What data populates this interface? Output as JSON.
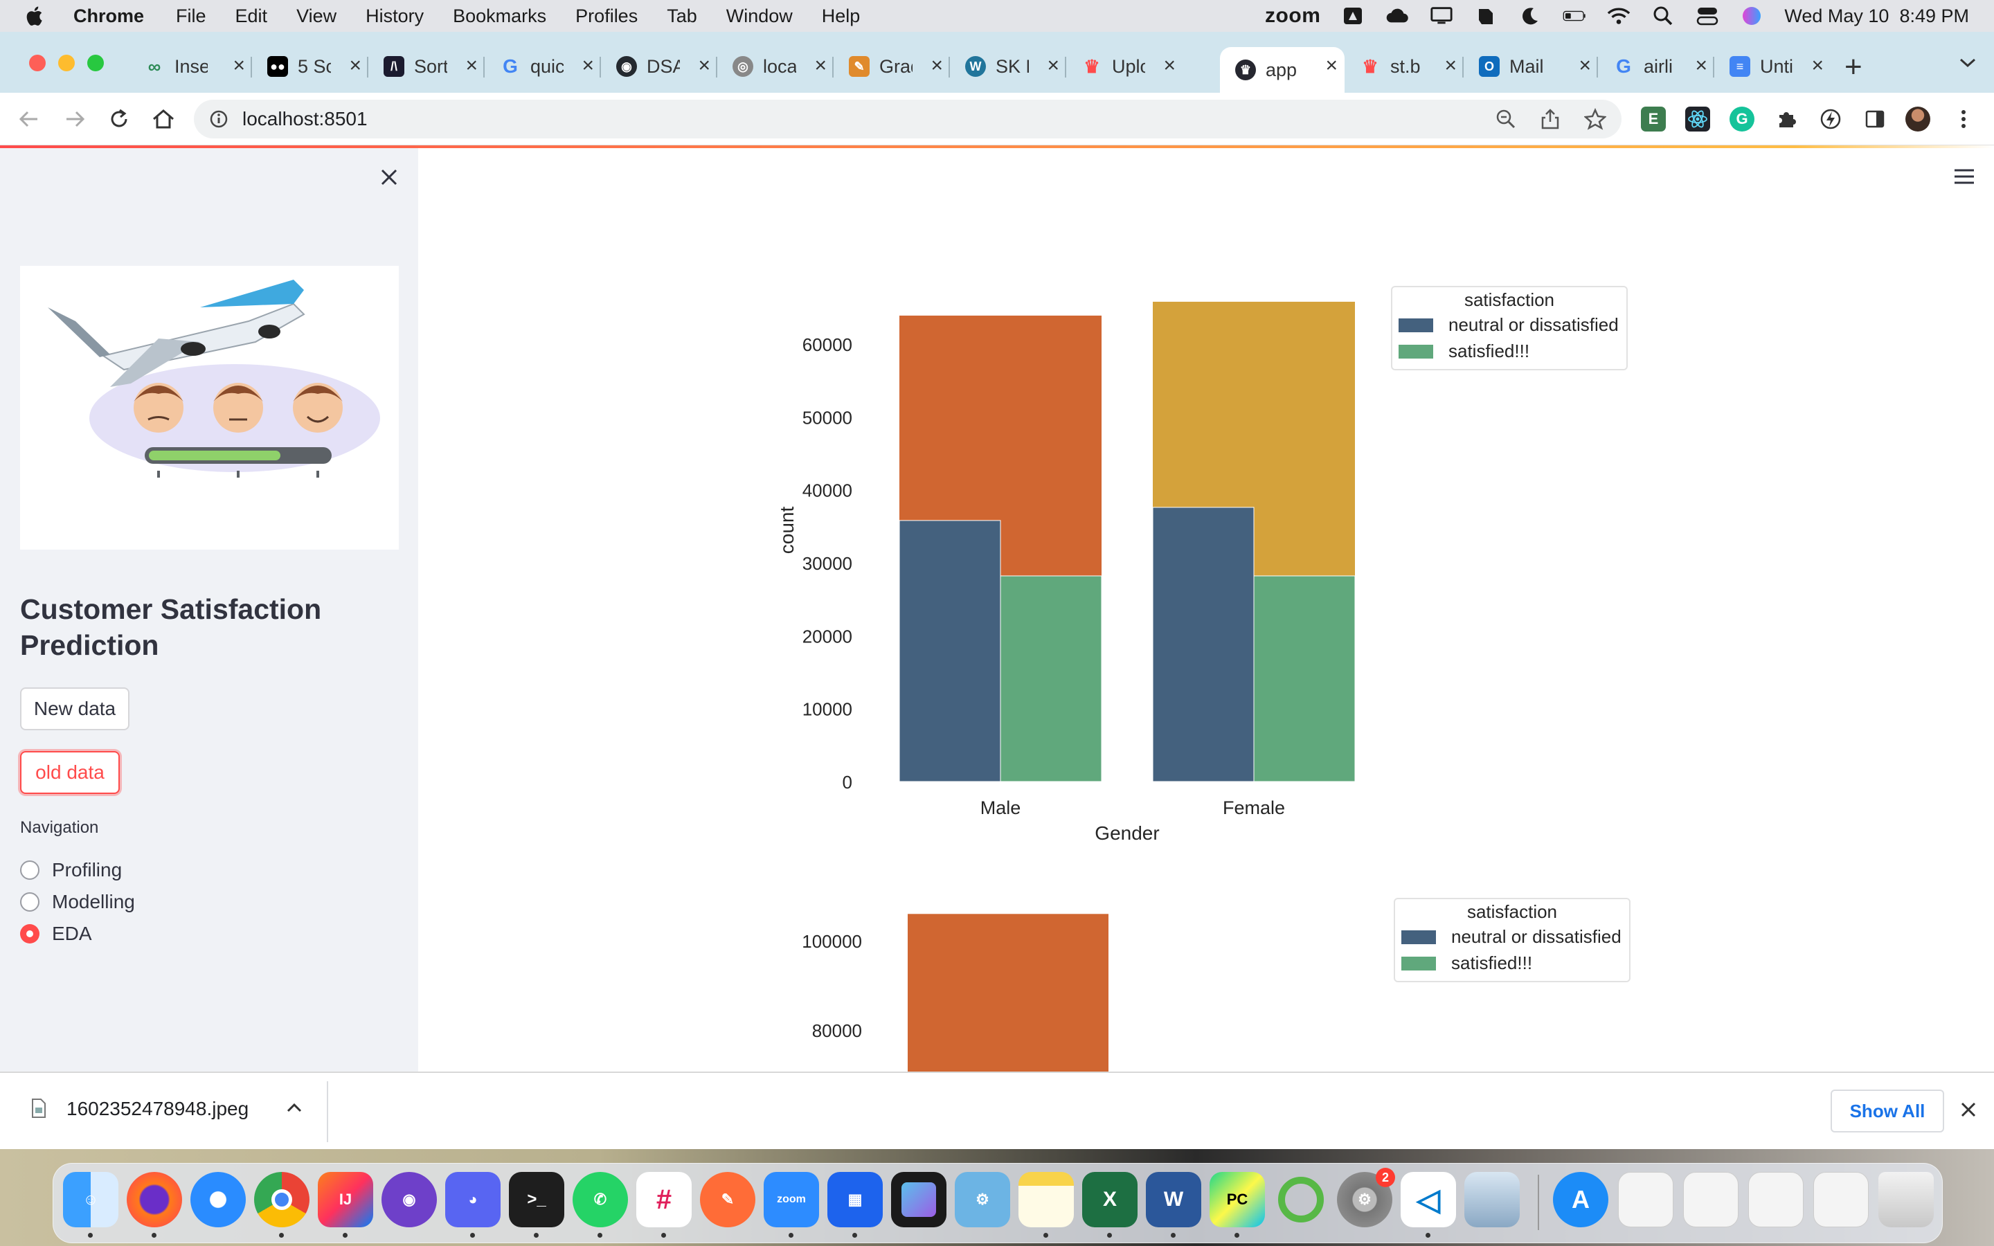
{
  "menubar": {
    "app": "Chrome",
    "items": [
      "File",
      "Edit",
      "View",
      "History",
      "Bookmarks",
      "Profiles",
      "Tab",
      "Window",
      "Help"
    ],
    "zoom": "zoom",
    "datetime": "Wed May 10  8:49 PM"
  },
  "tabs": [
    {
      "title": "Inse",
      "icon": "infinity-icon",
      "color": "#2e8b57"
    },
    {
      "title": "5 Sc",
      "icon": "medium-icon",
      "color": "#000000"
    },
    {
      "title": "Sort",
      "icon": "leetcode-icon",
      "color": "#1b1b2f"
    },
    {
      "title": "quic",
      "icon": "google-icon",
      "color": "#4285f4"
    },
    {
      "title": "DSA",
      "icon": "github-icon",
      "color": "#24292f"
    },
    {
      "title": "loca",
      "icon": "globe-icon",
      "color": "#666666"
    },
    {
      "title": "Grad",
      "icon": "pencil-icon",
      "color": "#e08a2c"
    },
    {
      "title": "SK P",
      "icon": "wordpress-icon",
      "color": "#21759b"
    },
    {
      "title": "Uplo",
      "icon": "streamlit-icon",
      "color": "#ff4b4b"
    },
    {
      "title": "app",
      "icon": "streamlit-icon",
      "color": "#262730",
      "active": true
    },
    {
      "title": "st.b",
      "icon": "streamlit-icon",
      "color": "#ff4b4b"
    },
    {
      "title": "Mail",
      "icon": "outlook-icon",
      "color": "#0f6cbd"
    },
    {
      "title": "airli",
      "icon": "google-icon",
      "color": "#4285f4"
    },
    {
      "title": "Unti",
      "icon": "docs-icon",
      "color": "#4285f4"
    }
  ],
  "address": {
    "url": "localhost:8501"
  },
  "sidebar": {
    "title": "Customer Satisfaction Prediction",
    "buttons": {
      "new": "New data",
      "old": "old data"
    },
    "nav_label": "Navigation",
    "nav_options": [
      "Profiling",
      "Modelling",
      "EDA"
    ],
    "nav_selected": "EDA"
  },
  "chart_data": [
    {
      "type": "bar",
      "xlabel": "Gender",
      "ylabel": "count",
      "categories": [
        "Male",
        "Female"
      ],
      "ylim": [
        0,
        66000
      ],
      "yticks": [
        0,
        10000,
        20000,
        30000,
        40000,
        50000,
        60000
      ],
      "series": [
        {
          "values": [
            63900,
            65800
          ],
          "colors": [
            "#d06631",
            "#d4a23b"
          ]
        },
        {
          "name": "neutral or dissatisfied",
          "values": [
            35800,
            37600
          ],
          "color": "#44617e"
        },
        {
          "name": "satisfied!!!",
          "values": [
            28200,
            28200
          ],
          "color": "#60a87c"
        }
      ],
      "legend": {
        "title": "satisfaction",
        "entries": [
          "neutral or dissatisfied",
          "satisfied!!!"
        ],
        "placement": "upper right outside"
      }
    },
    {
      "type": "bar",
      "yticks_visible": [
        80000,
        100000
      ],
      "categories": [
        ""
      ],
      "series": [
        {
          "values": [
            106000
          ],
          "color": "#d06631"
        }
      ],
      "legend": {
        "title": "satisfaction",
        "entries": [
          "neutral or dissatisfied",
          "satisfied!!!"
        ],
        "placement": "upper right outside"
      }
    }
  ],
  "download": {
    "filename": "1602352478948.jpeg",
    "show_all": "Show All"
  },
  "dock": {
    "badge": "2"
  }
}
